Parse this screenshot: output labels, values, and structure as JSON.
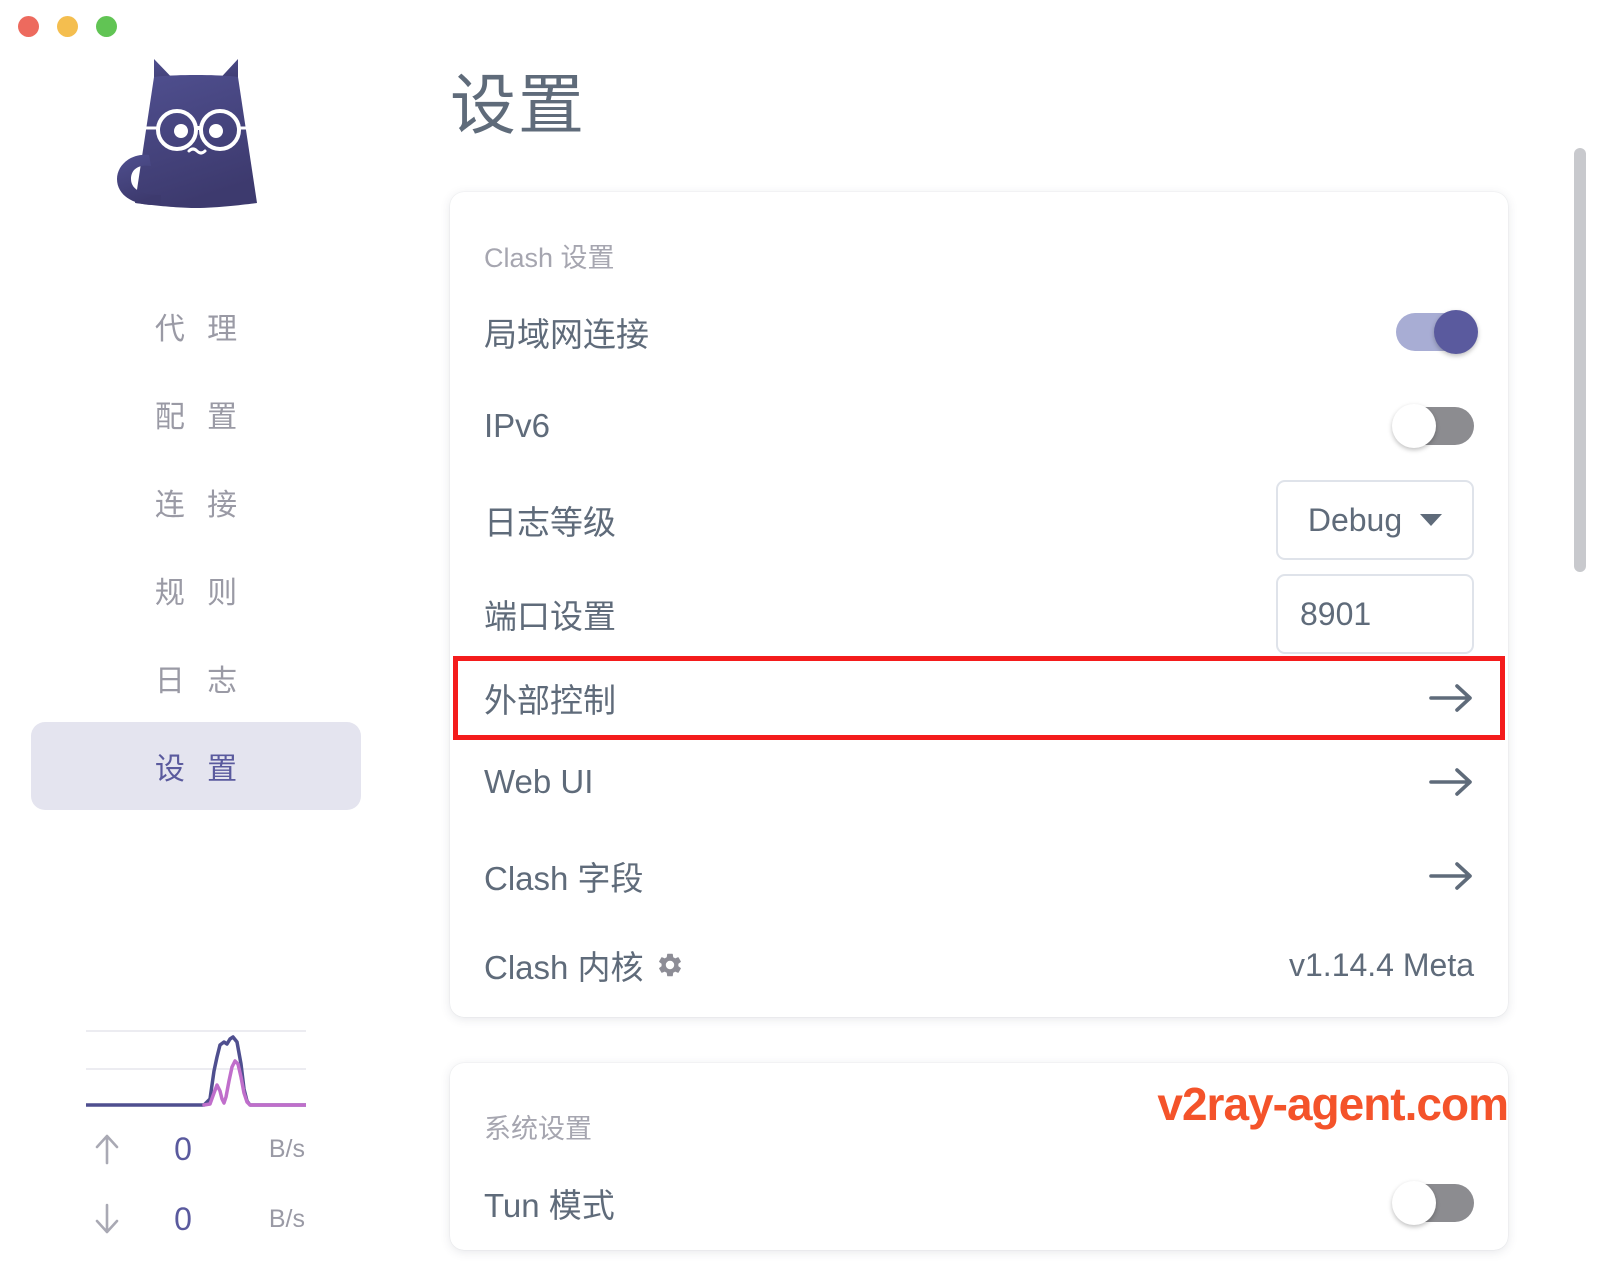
{
  "window": {
    "traffic_lights": [
      {
        "name": "close",
        "color": "#ED6A5E"
      },
      {
        "name": "minimize",
        "color": "#F4BE4F"
      },
      {
        "name": "maximize",
        "color": "#61C454"
      }
    ]
  },
  "sidebar": {
    "logo_name": "cat-logo",
    "items": [
      {
        "label": "代 理",
        "key": "proxies",
        "selected": false
      },
      {
        "label": "配 置",
        "key": "profiles",
        "selected": false
      },
      {
        "label": "连 接",
        "key": "connections",
        "selected": false
      },
      {
        "label": "规 则",
        "key": "rules",
        "selected": false
      },
      {
        "label": "日 志",
        "key": "logs",
        "selected": false
      },
      {
        "label": "设 置",
        "key": "settings",
        "selected": true
      }
    ],
    "traffic": {
      "upload_value": "0",
      "upload_unit": "B/s",
      "download_value": "0",
      "download_unit": "B/s",
      "upload_color": "#4f4f8f",
      "download_color": "#c06ecb"
    }
  },
  "main": {
    "title": "设置",
    "cards": [
      {
        "section_title": "Clash 设置",
        "rows": [
          {
            "label": "局域网连接",
            "control": "toggle",
            "state": "on"
          },
          {
            "label": "IPv6",
            "control": "toggle",
            "state": "off"
          },
          {
            "label": "日志等级",
            "control": "select",
            "value": "Debug"
          },
          {
            "label": "端口设置",
            "control": "input",
            "value": "8901"
          },
          {
            "label": "外部控制",
            "control": "arrow",
            "highlighted": true
          },
          {
            "label": "Web UI",
            "control": "arrow"
          },
          {
            "label": "Clash 字段",
            "control": "arrow"
          },
          {
            "label": "Clash 内核",
            "control": "text",
            "icon": "gear-icon",
            "value": "v1.14.4 Meta"
          }
        ]
      },
      {
        "section_title": "系统设置",
        "watermark": "v2ray-agent.com",
        "rows": [
          {
            "label": "Tun 模式",
            "control": "toggle",
            "state": "off"
          }
        ]
      }
    ]
  }
}
